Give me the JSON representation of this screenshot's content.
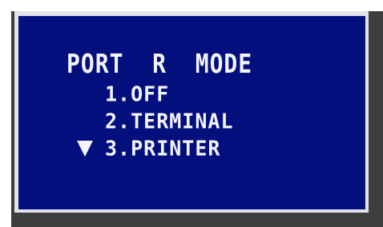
{
  "screen": {
    "title": "PORT  R  MODE",
    "options": [
      {
        "label": "1.OFF",
        "selected": false
      },
      {
        "label": "2.TERMINAL",
        "selected": false
      },
      {
        "label": "3.PRINTER",
        "selected": true
      }
    ],
    "cursor_icon": "triangle-down-icon"
  },
  "colors": {
    "bezel": "#3e3e3e",
    "screen_background": "#020f7c",
    "text": "#f4f4ff"
  }
}
